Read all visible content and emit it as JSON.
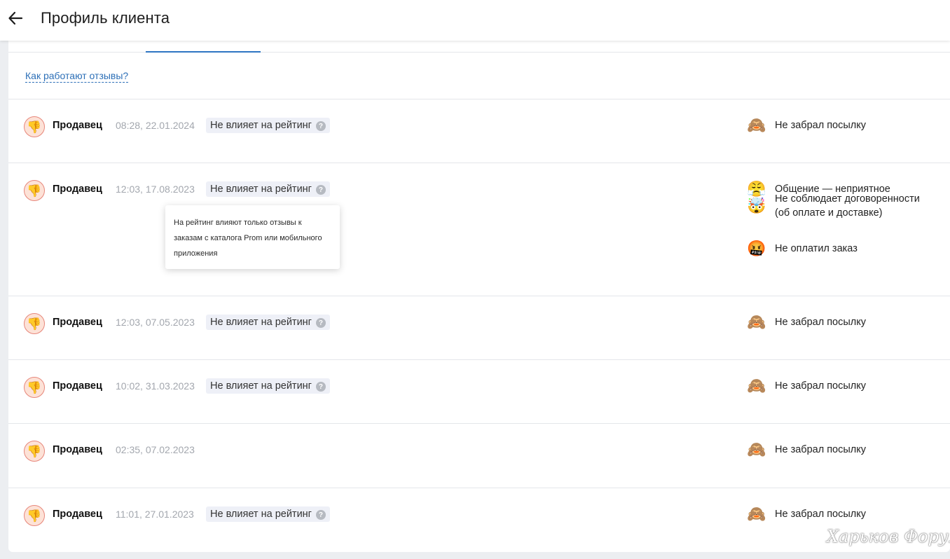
{
  "header": {
    "title": "Профиль клиента",
    "back_icon": "arrow-left-icon"
  },
  "help_link": "Как работают отзывы?",
  "tooltip": {
    "text": "На рейтинг влияют только отзывы к заказам с каталога Prom или мобильного приложения"
  },
  "colors": {
    "accent": "#2d75c3",
    "link": "#2c6fb7",
    "badge_bg": "#eef0f7",
    "avatar_border": "#e7867a"
  },
  "reviews": [
    {
      "author": "Продавец",
      "time": "08:28, 22.01.2024",
      "badge": "Не влияет на рейтинг",
      "avatar_icon": "thumbs-down-icon",
      "reasons": [
        {
          "icon": "see-no-evil-monkey-icon",
          "text": "Не забрал посылку"
        }
      ]
    },
    {
      "author": "Продавец",
      "time": "12:03, 17.08.2023",
      "badge": "Не влияет на рейтинг",
      "avatar_icon": "thumbs-down-icon",
      "reasons": [
        {
          "icon": "steaming-face-icon",
          "text": "Общение — неприятное"
        },
        {
          "icon": "exploding-head-icon",
          "text": "Не соблюдает договоренности (об оплате и доставке)"
        },
        {
          "icon": "cursing-face-icon",
          "text": "Не оплатил заказ"
        }
      ]
    },
    {
      "author": "Продавец",
      "time": "12:03, 07.05.2023",
      "badge": "Не влияет на рейтинг",
      "avatar_icon": "thumbs-down-icon",
      "reasons": [
        {
          "icon": "see-no-evil-monkey-icon",
          "text": "Не забрал посылку"
        }
      ]
    },
    {
      "author": "Продавец",
      "time": "10:02, 31.03.2023",
      "badge": "Не влияет на рейтинг",
      "avatar_icon": "thumbs-down-icon",
      "reasons": [
        {
          "icon": "see-no-evil-monkey-icon",
          "text": "Не забрал посылку"
        }
      ]
    },
    {
      "author": "Продавец",
      "time": "02:35, 07.02.2023",
      "badge": "",
      "avatar_icon": "thumbs-down-icon",
      "reasons": [
        {
          "icon": "see-no-evil-monkey-icon",
          "text": "Не забрал посылку"
        }
      ]
    },
    {
      "author": "Продавец",
      "time": "11:01, 27.01.2023",
      "badge": "Не влияет на рейтинг",
      "avatar_icon": "thumbs-down-icon",
      "reasons": [
        {
          "icon": "see-no-evil-monkey-icon",
          "text": "Не забрал посылку"
        }
      ]
    }
  ],
  "watermark": "Харьков Форум"
}
